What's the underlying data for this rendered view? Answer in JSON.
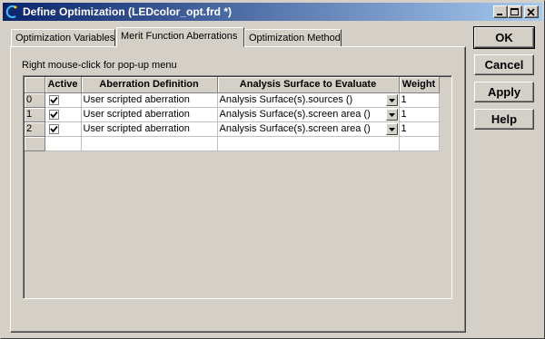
{
  "window": {
    "title": "Define Optimization   (LEDcolor_opt.frd *)",
    "app_icon": "optimization-icon",
    "controls": [
      "minimize-icon",
      "maximize-icon",
      "close-icon"
    ]
  },
  "tabs": [
    {
      "label": "Optimization Variables",
      "active": false
    },
    {
      "label": "Merit Function Aberrations",
      "active": true
    },
    {
      "label": "Optimization Method",
      "active": false
    }
  ],
  "panel": {
    "hint": "Right mouse-click for pop-up menu"
  },
  "grid": {
    "columns": [
      "",
      "Active",
      "Aberration Definition",
      "Analysis Surface to Evaluate",
      "Weight"
    ],
    "rows": [
      {
        "index": "0",
        "active": true,
        "definition": "User scripted aberration",
        "surface": "Analysis Surface(s).sources   ()",
        "weight": "1"
      },
      {
        "index": "1",
        "active": true,
        "definition": "User scripted aberration",
        "surface": "Analysis Surface(s).screen area   ()",
        "weight": "1"
      },
      {
        "index": "2",
        "active": true,
        "definition": "User scripted aberration",
        "surface": "Analysis Surface(s).screen area   ()",
        "weight": "1"
      }
    ]
  },
  "buttons": {
    "ok": "OK",
    "cancel": "Cancel",
    "apply": "Apply",
    "help": "Help"
  }
}
